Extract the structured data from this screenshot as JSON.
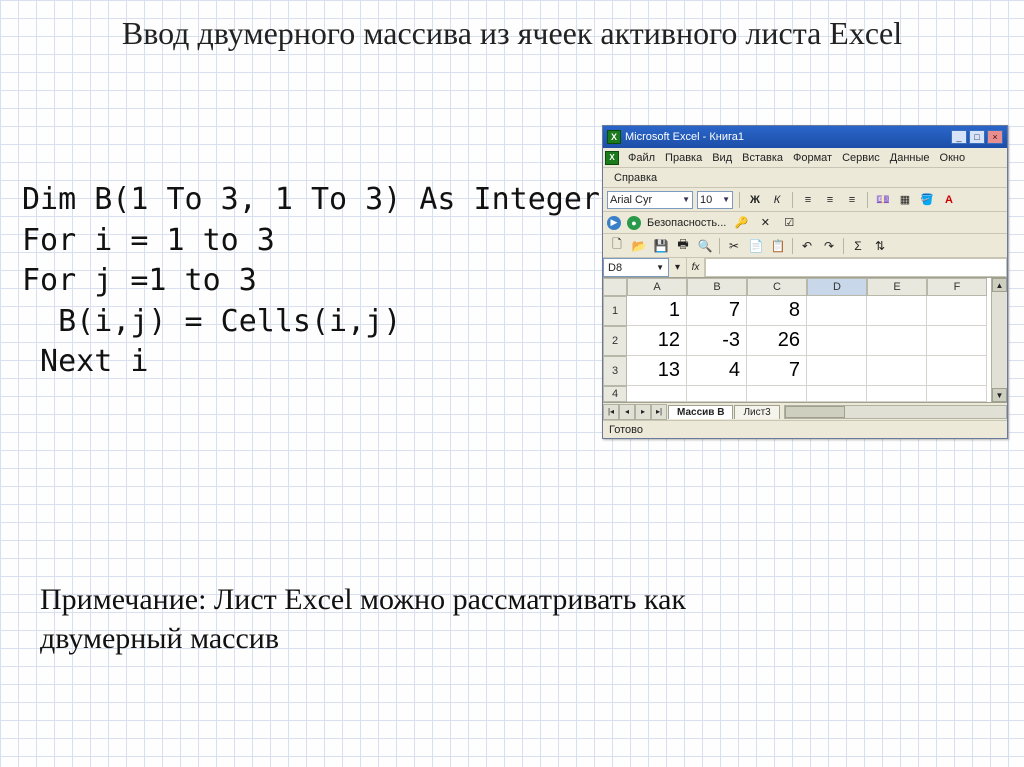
{
  "title": "Ввод двумерного массива из ячеек активного листа Excel",
  "code": "Dim B(1 To 3, 1 To 3) As Integer\nFor i = 1 to 3\nFor j =1 to 3\n  B(i,j) = Cells(i,j)\n Next i",
  "note": "Примечание: Лист Excel можно рассматривать как двумерный массив",
  "excel": {
    "window_title": "Microsoft Excel - Книга1",
    "menus": [
      "Файл",
      "Правка",
      "Вид",
      "Вставка",
      "Формат",
      "Сервис",
      "Данные",
      "Окно"
    ],
    "help_label": "Справка",
    "font_name": "Arial Cyr",
    "font_size": "10",
    "security_label": "Безопасность...",
    "name_box": "D8",
    "fx_label": "fx",
    "columns": [
      "A",
      "B",
      "C",
      "D",
      "E",
      "F"
    ],
    "selected_column": "D",
    "row_headers": [
      "1",
      "2",
      "3",
      "4"
    ],
    "cells": [
      [
        "1",
        "7",
        "8",
        "",
        "",
        ""
      ],
      [
        "12",
        "-3",
        "26",
        "",
        "",
        ""
      ],
      [
        "13",
        "4",
        "7",
        "",
        "",
        ""
      ],
      [
        "",
        "",
        "",
        "",
        "",
        ""
      ]
    ],
    "tabs": [
      "Массив В",
      "Лист3"
    ],
    "active_tab": "Массив В",
    "status": "Готово"
  }
}
